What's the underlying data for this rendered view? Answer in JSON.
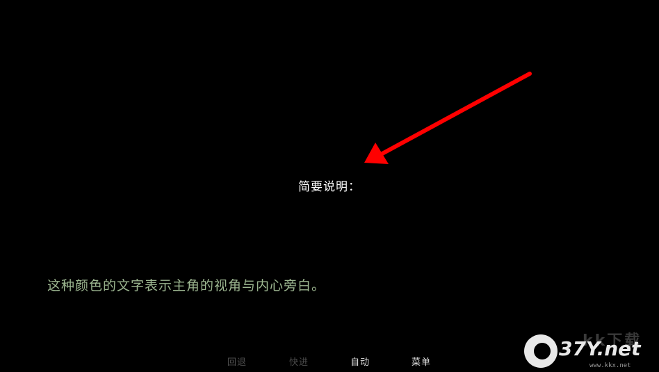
{
  "scene": {
    "heading": "简要说明：",
    "narration": "这种颜色的文字表示主角的视角与内心旁白。",
    "narration_color": "#9bb58f",
    "annotation_arrow_color": "#ff0000"
  },
  "quick_menu": {
    "rollback": "回退",
    "skip": "快进",
    "auto": "自动",
    "menu": "菜单"
  },
  "watermark": {
    "faded": "kk下载",
    "main": "37Y.net",
    "sub": "www.kkx.net"
  }
}
